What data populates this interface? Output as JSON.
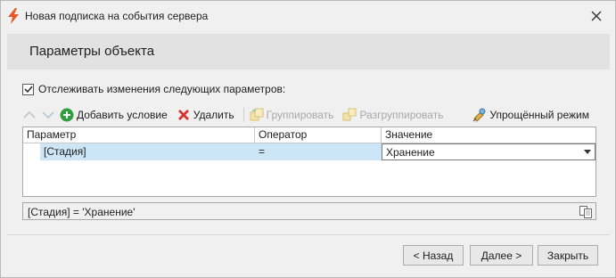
{
  "window": {
    "title": "Новая подписка на события сервера",
    "accent_color": "#e8572a"
  },
  "header": {
    "title": "Параметры объекта"
  },
  "track": {
    "checked": true,
    "label": "Отслеживать изменения следующих параметров:"
  },
  "toolbar": {
    "move_up_icon": "chevron-up-icon",
    "move_down_icon": "chevron-down-icon",
    "add_label": "Добавить условие",
    "delete_label": "Удалить",
    "group_label": "Группировать",
    "ungroup_label": "Разгруппировать",
    "simple_mode_label": "Упрощённый режим"
  },
  "grid": {
    "columns": [
      "Параметр",
      "Оператор",
      "Значение"
    ],
    "rows": [
      {
        "parameter": "[Стадия]",
        "operator": "=",
        "value": "Хранение"
      }
    ],
    "selection_color": "#cde6f7"
  },
  "expression": {
    "text": "[Стадия] = 'Хранение'"
  },
  "footer": {
    "back_label": "< Назад",
    "next_label": "Далее >",
    "close_label": "Закрыть"
  }
}
